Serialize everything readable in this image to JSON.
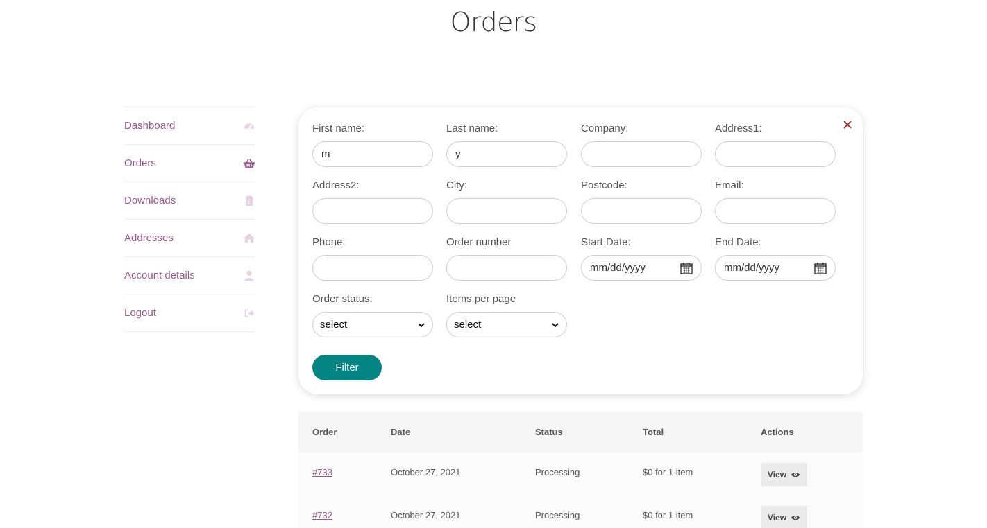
{
  "page": {
    "title": "Orders"
  },
  "sidebar": {
    "items": [
      {
        "label": "Dashboard",
        "icon": "dashboard-icon",
        "active": false
      },
      {
        "label": "Orders",
        "icon": "basket-icon",
        "active": true
      },
      {
        "label": "Downloads",
        "icon": "file-icon",
        "active": false
      },
      {
        "label": "Addresses",
        "icon": "home-icon",
        "active": false
      },
      {
        "label": "Account details",
        "icon": "user-icon",
        "active": false
      },
      {
        "label": "Logout",
        "icon": "logout-icon",
        "active": false
      }
    ]
  },
  "filter": {
    "fields": {
      "first_name": {
        "label": "First name:",
        "value": "m"
      },
      "last_name": {
        "label": "Last name:",
        "value": "y"
      },
      "company": {
        "label": "Company:",
        "value": ""
      },
      "address1": {
        "label": "Address1:",
        "value": ""
      },
      "address2": {
        "label": "Address2:",
        "value": ""
      },
      "city": {
        "label": "City:",
        "value": ""
      },
      "postcode": {
        "label": "Postcode:",
        "value": ""
      },
      "email": {
        "label": "Email:",
        "value": ""
      },
      "phone": {
        "label": "Phone:",
        "value": ""
      },
      "order_number": {
        "label": "Order number",
        "value": ""
      },
      "start_date": {
        "label": "Start Date:",
        "placeholder": "mm/dd/yyyy"
      },
      "end_date": {
        "label": "End Date:",
        "placeholder": "mm/dd/yyyy"
      },
      "order_status": {
        "label": "Order status:",
        "selected": "select"
      },
      "items_per_page": {
        "label": "Items per page",
        "selected": "select"
      }
    },
    "button_label": "Filter"
  },
  "table": {
    "headers": {
      "order": "Order",
      "date": "Date",
      "status": "Status",
      "total": "Total",
      "actions": "Actions"
    },
    "rows": [
      {
        "order": "#733",
        "date": "October 27, 2021",
        "status": "Processing",
        "total": "$0 for 1 item",
        "action": "View"
      },
      {
        "order": "#732",
        "date": "October 27, 2021",
        "status": "Processing",
        "total": "$0 for 1 item",
        "action": "View"
      }
    ]
  },
  "colors": {
    "accent": "#96588a",
    "button": "#058484",
    "close": "#a33a3a"
  }
}
